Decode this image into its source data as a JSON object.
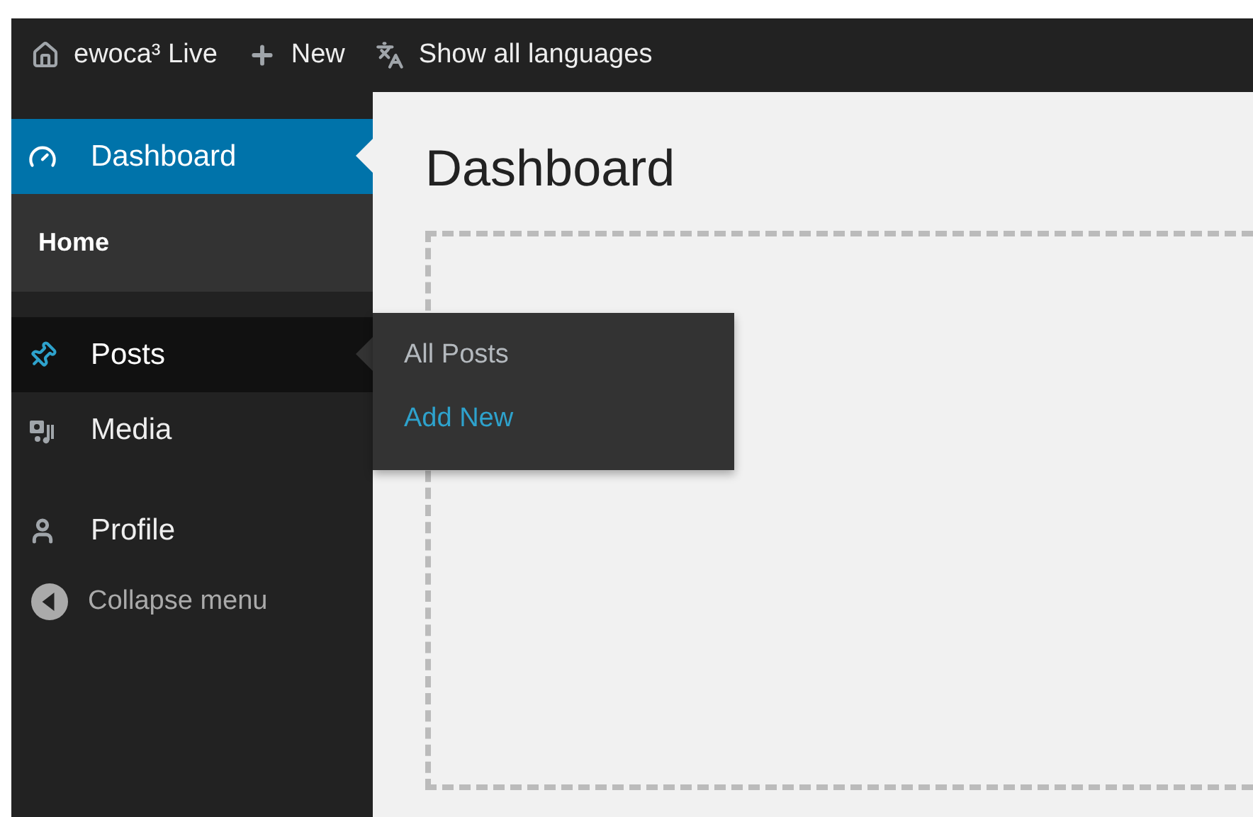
{
  "toolbar": [
    {
      "kind": "home",
      "label": "ewoca³ Live"
    },
    {
      "kind": "new",
      "label": "New"
    },
    {
      "kind": "languages",
      "label": "Show all languages"
    }
  ],
  "sidebar": {
    "groups": [
      [
        {
          "kind": "dashboard",
          "label": "Dashboard",
          "selected": true,
          "hovered": false,
          "submenu": [
            {
              "label": "Home",
              "selected": true,
              "highlighted": false
            }
          ]
        }
      ],
      [
        {
          "kind": "posts",
          "label": "Posts",
          "selected": false,
          "hovered": true,
          "flyout": [
            {
              "label": "All Posts",
              "highlighted": false
            },
            {
              "label": "Add New",
              "highlighted": true
            }
          ]
        },
        {
          "kind": "media",
          "label": "Media",
          "selected": false,
          "hovered": false
        }
      ],
      [
        {
          "kind": "profile",
          "label": "Profile",
          "selected": false,
          "hovered": false
        }
      ]
    ],
    "collapse": {
      "label": "Collapse menu"
    }
  },
  "page": {
    "title": "Dashboard"
  }
}
